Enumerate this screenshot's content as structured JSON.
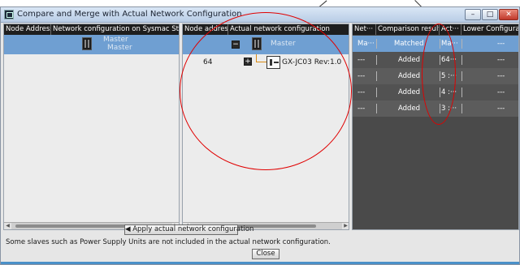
{
  "window": {
    "title": "Compare and Merge with Actual Network Configuration",
    "minimize_label": "–",
    "maximize_label": "□",
    "close_label": "✕"
  },
  "left_pane": {
    "headers": [
      "Node Address",
      "Network configuration on Sysmac Studio"
    ],
    "rows": [
      {
        "node": "",
        "device_name": "Master",
        "device_sub": "Master",
        "selected": true
      }
    ]
  },
  "middle_pane": {
    "headers": [
      "Node address",
      "Actual network configuration"
    ],
    "rows": [
      {
        "node": "",
        "expander": "−",
        "device_name": "Master",
        "selected": true
      },
      {
        "node": "64",
        "expander": "+",
        "device_name": "GX-JC03 Rev:1.0",
        "selected": false
      }
    ]
  },
  "right_pane": {
    "headers": [
      "Net···",
      "Comparison result",
      "Act···",
      "Lower Configuratio"
    ],
    "rows": [
      {
        "net": "Ma···",
        "result": "Matched",
        "act": "Ma···",
        "lower": "---",
        "selected": true
      },
      {
        "net": "---",
        "result": "Added",
        "act": "64···",
        "lower": "---",
        "selected": false
      },
      {
        "net": "---",
        "result": "Added",
        "act": "5 :···",
        "lower": "---",
        "selected": false
      },
      {
        "net": "---",
        "result": "Added",
        "act": "4 :···",
        "lower": "---",
        "selected": false
      },
      {
        "net": "---",
        "result": "Added",
        "act": "3 :···",
        "lower": "---",
        "selected": false
      }
    ]
  },
  "buttons": {
    "apply": "◀ Apply actual network configuration",
    "close": "Close"
  },
  "note": "Some slaves such as Power Supply Units are not included in the actual network configuration.",
  "colors": {
    "selection": "#6f9fd2",
    "header": "#1e1e1e",
    "annotation": "#e00000",
    "connector": "#d98b16"
  }
}
